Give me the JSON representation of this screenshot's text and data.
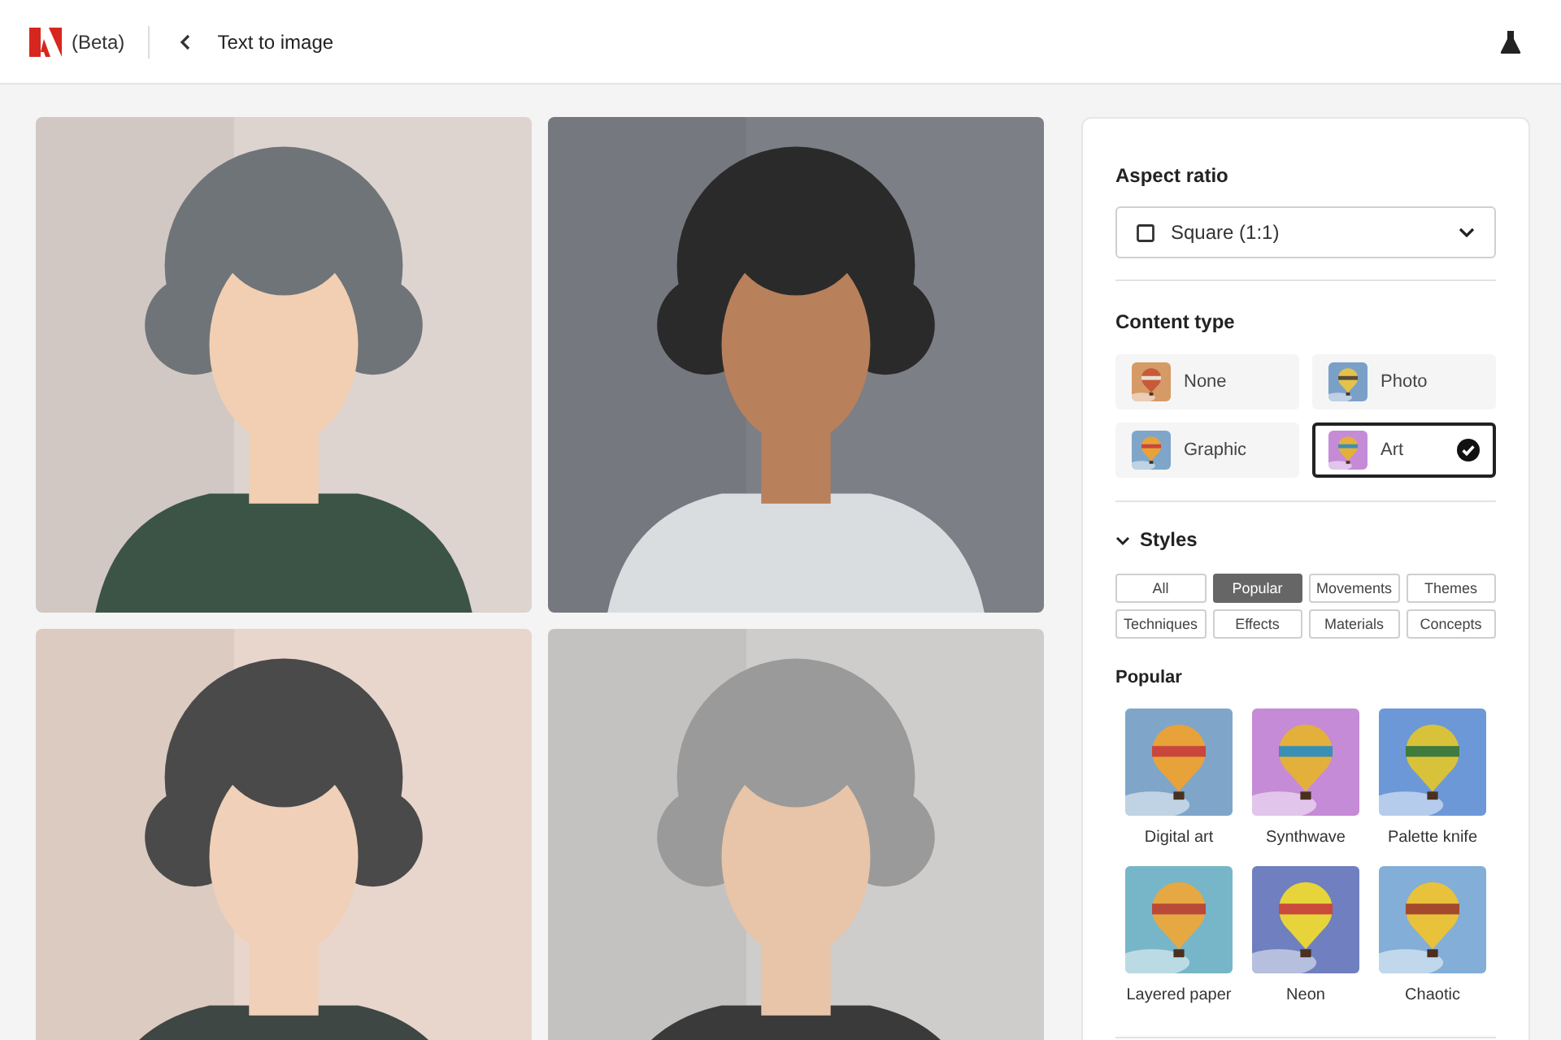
{
  "header": {
    "badge": "(Beta)",
    "title": "Text to image"
  },
  "panel": {
    "aspect_ratio": {
      "label": "Aspect ratio",
      "value": "Square (1:1)"
    },
    "content_type": {
      "label": "Content type",
      "options": [
        {
          "label": "None",
          "selected": false
        },
        {
          "label": "Photo",
          "selected": false
        },
        {
          "label": "Graphic",
          "selected": false
        },
        {
          "label": "Art",
          "selected": true
        }
      ]
    },
    "styles": {
      "label": "Styles",
      "expanded": true,
      "filters": [
        {
          "label": "All",
          "selected": false
        },
        {
          "label": "Popular",
          "selected": true
        },
        {
          "label": "Movements",
          "selected": false
        },
        {
          "label": "Themes",
          "selected": false
        },
        {
          "label": "Techniques",
          "selected": false
        },
        {
          "label": "Effects",
          "selected": false
        },
        {
          "label": "Materials",
          "selected": false
        },
        {
          "label": "Concepts",
          "selected": false
        }
      ],
      "section": "Popular",
      "items": [
        {
          "label": "Digital art"
        },
        {
          "label": "Synthwave"
        },
        {
          "label": "Palette knife"
        },
        {
          "label": "Layered paper"
        },
        {
          "label": "Neon"
        },
        {
          "label": "Chaotic"
        }
      ]
    }
  }
}
